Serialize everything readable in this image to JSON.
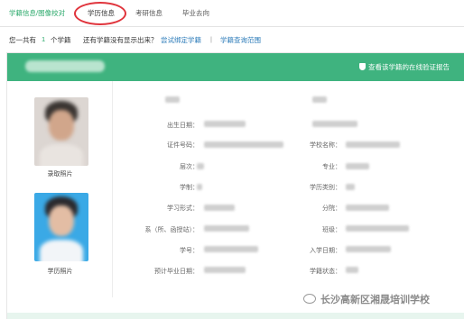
{
  "tabs": [
    {
      "label": "学籍信息/图像校对",
      "state": "link"
    },
    {
      "label": "学历信息",
      "state": "active"
    },
    {
      "label": "考研信息",
      "state": "normal"
    },
    {
      "label": "毕业去向",
      "state": "normal"
    }
  ],
  "count_bar": {
    "prefix": "您一共有",
    "count": "1",
    "suffix": "个学籍",
    "question": "还有学籍没有显示出来？",
    "bind_link": "尝试绑定学籍",
    "separator": "|",
    "scope_link": "学籍查询范围"
  },
  "card": {
    "verify_link": "查看该学籍的在线验证报告",
    "photo1_label": "录取照片",
    "photo2_label": "学历照片",
    "left_fields": [
      "出生日期：",
      "证件号码：",
      "层次：",
      "学制：",
      "学习形式：",
      "系（所、函授站）：",
      "学号：",
      "预计毕业日期："
    ],
    "right_fields": [
      "学校名称：",
      "专业：",
      "学历类别：",
      "分院：",
      "班级：",
      "入学日期：",
      "学籍状态："
    ]
  },
  "watermark": "长沙高新区湘晟培训学校",
  "colors": {
    "accent_green": "#3fb37f",
    "link_blue": "#2a7ab8",
    "highlight_circle": "#e0343c"
  }
}
